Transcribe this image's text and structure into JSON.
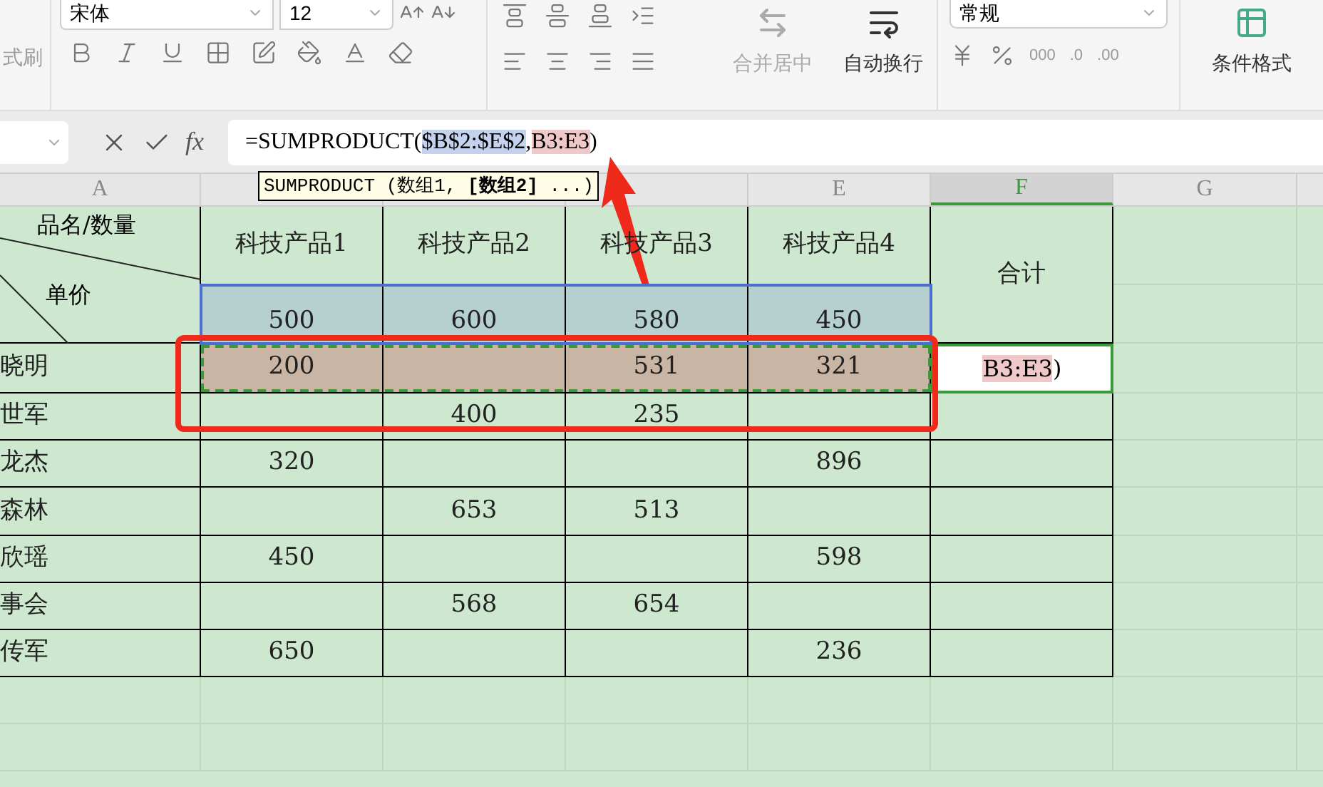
{
  "ribbon": {
    "format_painter_label": "式刷",
    "font_name": "宋体",
    "font_size": "12",
    "merge_label": "合并居中",
    "merge_disabled": true,
    "wrap_label": "自动换行",
    "number_format": "常规",
    "thousands_label": "000",
    "decimal_labels": [
      ".0",
      ".00"
    ],
    "conditional_label": "条件格式"
  },
  "formula_bar": {
    "fx_label": "fx",
    "parts": [
      {
        "text": "=SUMPRODUCT("
      },
      {
        "text": "$B$2:$E$2",
        "color": "#c5d2ee"
      },
      {
        "text": ","
      },
      {
        "text": "B3:E3",
        "color": "#efc9c9"
      },
      {
        "text": ")"
      }
    ]
  },
  "tooltip": "SUMPRODUCT (数组1, **[数组2]** ...)",
  "columns": [
    {
      "label": "A",
      "selected": false
    },
    {
      "selected": false
    },
    {
      "selected": false
    },
    {
      "selected": false
    },
    {
      "label": "E",
      "selected": false
    },
    {
      "label": "F",
      "selected": true
    },
    {
      "label": "G",
      "selected": false
    }
  ],
  "header": {
    "diagonal_top": "品名/数量",
    "diagonal_bottom": "单价",
    "products": [
      "科技产品1",
      "科技产品2",
      "科技产品3",
      "科技产品4"
    ],
    "total": "合计"
  },
  "price_row": {
    "referenced": true,
    "values": [
      "500",
      "600",
      "580",
      "450"
    ]
  },
  "rows": [
    {
      "name": "晓明",
      "referenced": true,
      "product_1": "200",
      "product_3": "531",
      "product_4": "321"
    },
    {
      "name": "世军",
      "referenced": false,
      "product_2": "400",
      "product_3": "235"
    },
    {
      "name": "龙杰",
      "referenced": false,
      "product_1": "320",
      "product_4": "896"
    },
    {
      "name": "森林",
      "referenced": false,
      "product_2": "653",
      "product_3": "513"
    },
    {
      "name": "欣瑶",
      "referenced": false,
      "product_1": "450",
      "product_4": "598"
    },
    {
      "name": "事会",
      "referenced": false,
      "product_2": "568",
      "product_3": "654"
    },
    {
      "name": "传军",
      "referenced": false,
      "product_1": "650",
      "product_4": "236"
    }
  ],
  "active_cell": {
    "parts": [
      {
        "text": "B3:E3",
        "color": "#efc9c9"
      },
      {
        "text": ")"
      }
    ]
  }
}
